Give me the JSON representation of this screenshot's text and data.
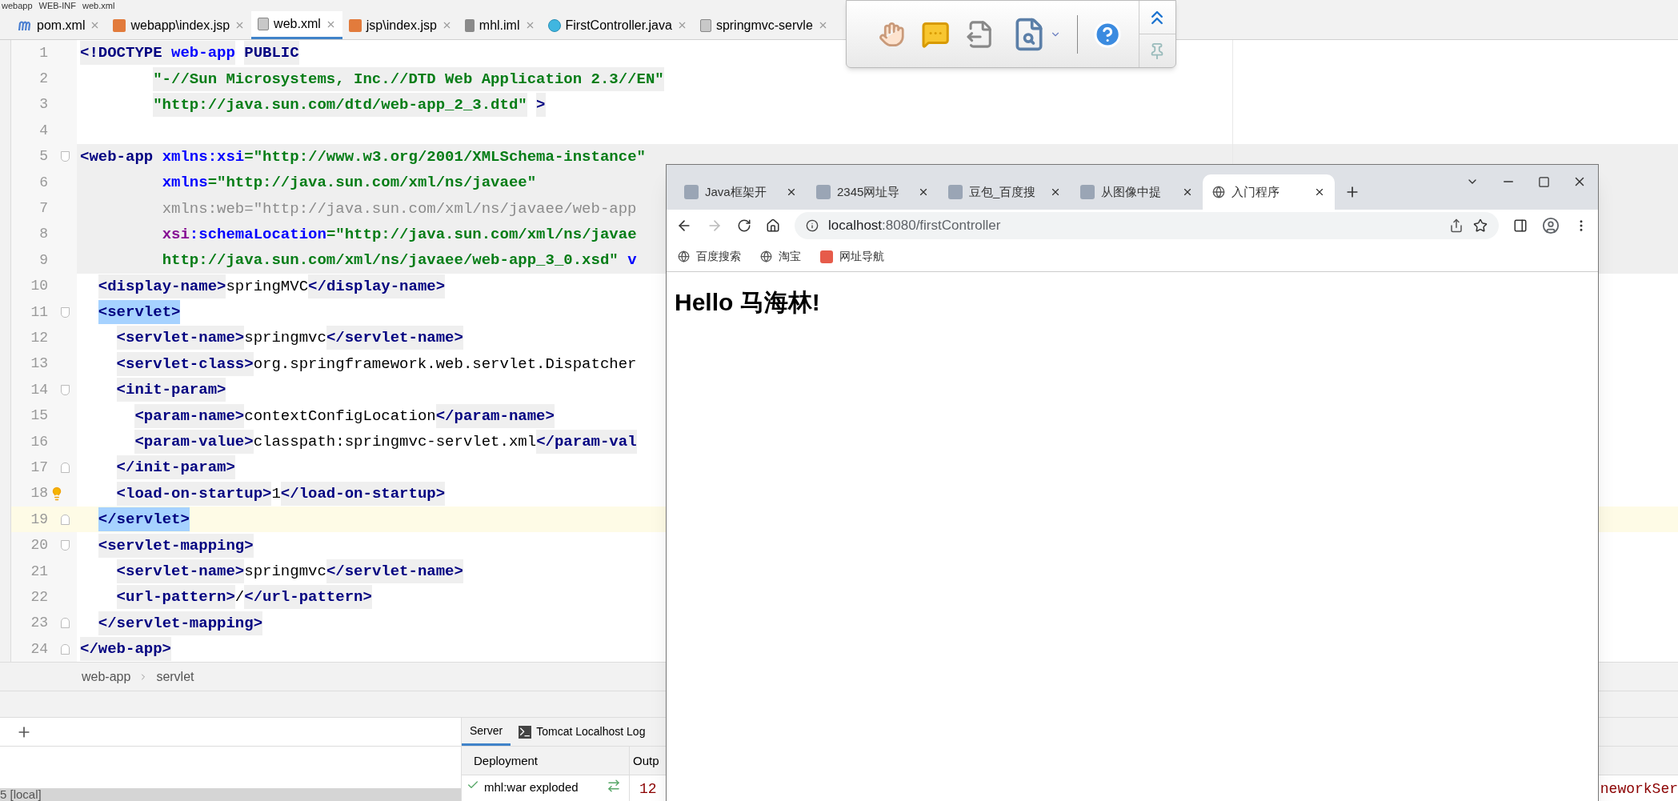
{
  "breadcrumb_top": [
    "webapp",
    "WEB-INF",
    "web.xml"
  ],
  "editor_tabs": [
    {
      "label": "pom.xml",
      "selected": false
    },
    {
      "label": "webapp\\index.jsp",
      "selected": false
    },
    {
      "label": "web.xml",
      "selected": true
    },
    {
      "label": "jsp\\index.jsp",
      "selected": false
    },
    {
      "label": "mhl.iml",
      "selected": false
    },
    {
      "label": "FirstController.java",
      "selected": false
    },
    {
      "label": "springmvc-servle",
      "selected": false
    }
  ],
  "code_lines": [
    {
      "number": "1",
      "block": false,
      "current": false,
      "fold_start": false,
      "fold_end": false,
      "bulb": false,
      "segments": [
        {
          "kind": "tag",
          "text": "<!DOCTYPE "
        },
        {
          "kind": "name",
          "text": "web-app"
        },
        {
          "kind": "tag",
          "text": " PUBLIC"
        }
      ]
    },
    {
      "number": "2",
      "block": false,
      "current": false,
      "fold_start": false,
      "fold_end": false,
      "bulb": false,
      "segments": [
        {
          "kind": "value",
          "text": "        \"-//Sun Microsystems, Inc.//DTD Web Application 2.3//EN\""
        }
      ]
    },
    {
      "number": "3",
      "block": false,
      "current": false,
      "fold_start": false,
      "fold_end": false,
      "bulb": false,
      "segments": [
        {
          "kind": "value",
          "text": "        \"http://java.sun.com/dtd/web-app_2_3.dtd\""
        },
        {
          "kind": "tag",
          "text": " >"
        }
      ]
    },
    {
      "number": "4",
      "block": false,
      "current": false,
      "fold_start": false,
      "fold_end": false,
      "bulb": false
    },
    {
      "number": "5",
      "block": true,
      "current": false,
      "fold_start": true,
      "fold_end": false,
      "bulb": false,
      "segments": [
        {
          "kind": "tag",
          "text": "<web-app "
        },
        {
          "kind": "name",
          "text": "xmlns:xsi"
        },
        {
          "kind": "value",
          "text": "=\"http://www.w3.org/2001/XMLSchema-instance\""
        }
      ]
    },
    {
      "number": "6",
      "block": true,
      "current": false,
      "fold_start": false,
      "fold_end": false,
      "bulb": false,
      "segments": [
        {
          "kind": "name",
          "text": "         xmlns"
        },
        {
          "kind": "value",
          "text": "=\"http://java.sun.com/xml/ns/javaee\""
        }
      ]
    },
    {
      "number": "7",
      "block": true,
      "current": false,
      "fold_start": false,
      "fold_end": false,
      "bulb": false,
      "segments": [
        {
          "kind": "muted",
          "text": "         xmlns:web=\"http://java.sun.com/xml/ns/javaee/web-app"
        }
      ]
    },
    {
      "number": "8",
      "block": true,
      "current": false,
      "fold_start": false,
      "fold_end": false,
      "bulb": false,
      "segments": [
        {
          "kind": "prefix",
          "text": "         xsi"
        },
        {
          "kind": "name",
          "text": ":schemaLocation"
        },
        {
          "kind": "value",
          "text": "=\"http://java.sun.com/xml/ns/javae"
        }
      ]
    },
    {
      "number": "9",
      "block": true,
      "current": false,
      "fold_start": false,
      "fold_end": false,
      "bulb": false,
      "segments": [
        {
          "kind": "value",
          "text": "         http://java.sun.com/xml/ns/javaee/web-app_3_0.xsd\""
        },
        {
          "kind": "name",
          "text": " v"
        }
      ]
    },
    {
      "number": "10",
      "block": false,
      "current": false,
      "fold_start": false,
      "fold_end": false,
      "bulb": false,
      "segments": [
        {
          "kind": "tag",
          "text": "  <display-name>"
        },
        {
          "kind": "text",
          "text": "springMVC"
        },
        {
          "kind": "tag",
          "text": "</display-name>"
        }
      ]
    },
    {
      "number": "11",
      "block": false,
      "current": false,
      "fold_start": true,
      "fold_end": false,
      "bulb": false,
      "segments": [
        {
          "kind": "matched",
          "text": "  <servlet>"
        }
      ]
    },
    {
      "number": "12",
      "block": false,
      "current": false,
      "fold_start": false,
      "fold_end": false,
      "bulb": false,
      "segments": [
        {
          "kind": "tag",
          "text": "    <servlet-name>"
        },
        {
          "kind": "text",
          "text": "springmvc"
        },
        {
          "kind": "tag",
          "text": "</servlet-name>"
        }
      ]
    },
    {
      "number": "13",
      "block": false,
      "current": false,
      "fold_start": false,
      "fold_end": false,
      "bulb": false,
      "segments": [
        {
          "kind": "tag",
          "text": "    <servlet-class>"
        },
        {
          "kind": "text",
          "text": "org.springframework.web.servlet.Dispatcher"
        }
      ]
    },
    {
      "number": "14",
      "block": false,
      "current": false,
      "fold_start": true,
      "fold_end": false,
      "bulb": false,
      "segments": [
        {
          "kind": "tag",
          "text": "    <init-param>"
        }
      ]
    },
    {
      "number": "15",
      "block": false,
      "current": false,
      "fold_start": false,
      "fold_end": false,
      "bulb": false,
      "segments": [
        {
          "kind": "tag",
          "text": "      <param-name>"
        },
        {
          "kind": "text",
          "text": "contextConfigLocation"
        },
        {
          "kind": "tag",
          "text": "</param-name>"
        }
      ]
    },
    {
      "number": "16",
      "block": false,
      "current": false,
      "fold_start": false,
      "fold_end": false,
      "bulb": false,
      "segments": [
        {
          "kind": "tag",
          "text": "      <param-value>"
        },
        {
          "kind": "text",
          "text": "classpath:springmvc-servlet.xml"
        },
        {
          "kind": "tag",
          "text": "</param-val"
        }
      ]
    },
    {
      "number": "17",
      "block": false,
      "current": false,
      "fold_start": false,
      "fold_end": true,
      "bulb": false,
      "segments": [
        {
          "kind": "tag",
          "text": "    </init-param>"
        }
      ]
    },
    {
      "number": "18",
      "block": false,
      "current": false,
      "fold_start": false,
      "fold_end": false,
      "bulb": true,
      "segments": [
        {
          "kind": "tag",
          "text": "    <load-on-startup>"
        },
        {
          "kind": "text",
          "text": "1"
        },
        {
          "kind": "tag",
          "text": "</load-on-startup>"
        }
      ]
    },
    {
      "number": "19",
      "block": false,
      "current": true,
      "fold_start": false,
      "fold_end": true,
      "bulb": false,
      "segments": [
        {
          "kind": "matched",
          "text": "  </servlet>"
        }
      ]
    },
    {
      "number": "20",
      "block": false,
      "current": false,
      "fold_start": true,
      "fold_end": false,
      "bulb": false,
      "segments": [
        {
          "kind": "tag",
          "text": "  <servlet-mapping>"
        }
      ]
    },
    {
      "number": "21",
      "block": false,
      "current": false,
      "fold_start": false,
      "fold_end": false,
      "bulb": false,
      "segments": [
        {
          "kind": "tag",
          "text": "    <servlet-name>"
        },
        {
          "kind": "text",
          "text": "springmvc"
        },
        {
          "kind": "tag",
          "text": "</servlet-name>"
        }
      ]
    },
    {
      "number": "22",
      "block": false,
      "current": false,
      "fold_start": false,
      "fold_end": false,
      "bulb": false,
      "segments": [
        {
          "kind": "tag",
          "text": "    <url-pattern>"
        },
        {
          "kind": "text",
          "text": "/"
        },
        {
          "kind": "tag",
          "text": "</url-pattern>"
        }
      ]
    },
    {
      "number": "23",
      "block": false,
      "current": false,
      "fold_start": false,
      "fold_end": true,
      "bulb": false,
      "segments": [
        {
          "kind": "tag",
          "text": "  </servlet-mapping>"
        }
      ]
    },
    {
      "number": "24",
      "block": false,
      "current": false,
      "fold_start": false,
      "fold_end": true,
      "bulb": false,
      "segments": [
        {
          "kind": "tag",
          "text": "</web-app>"
        }
      ]
    }
  ],
  "breadcrumb": [
    "web-app",
    "servlet"
  ],
  "services": {
    "tabs": [
      {
        "label": "Server",
        "selected": true
      },
      {
        "label": "Tomcat Localhost Log",
        "selected": false
      }
    ],
    "deployment_header": "Deployment",
    "output_header": "Outp",
    "deployment": "mhl:war exploded",
    "output": "12",
    "output_tail": "neworkSer",
    "tree_item": "5 [local]"
  },
  "browser": {
    "tabs": [
      {
        "label": "Java框架开",
        "selected": false
      },
      {
        "label": "2345网址导",
        "selected": false
      },
      {
        "label": "豆包_百度搜",
        "selected": false
      },
      {
        "label": "从图像中提",
        "selected": false
      },
      {
        "label": "入门程序",
        "selected": true
      }
    ],
    "host": "localhost",
    "path": ":8080/firstController",
    "bookmarks": [
      "百度搜索",
      "淘宝",
      "网址导航"
    ],
    "heading": "Hello 马海林!"
  }
}
